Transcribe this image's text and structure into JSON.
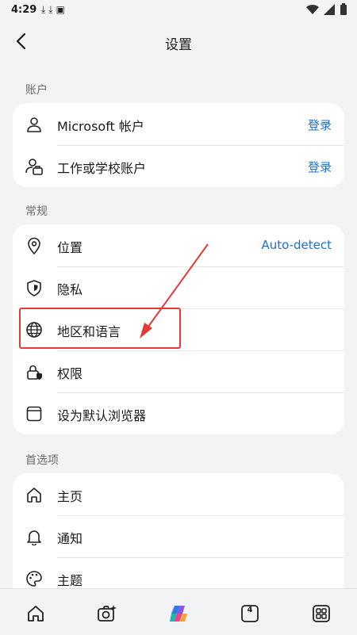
{
  "status": {
    "time": "4:29"
  },
  "appbar": {
    "title": "设置"
  },
  "sections": {
    "account": {
      "label": "账户",
      "items": [
        {
          "label": "Microsoft 帐户",
          "action": "登录",
          "icon": "person-icon"
        },
        {
          "label": "工作或学校账户",
          "action": "登录",
          "icon": "work-account-icon"
        }
      ]
    },
    "general": {
      "label": "常规",
      "items": [
        {
          "label": "位置",
          "action": "Auto-detect",
          "icon": "location-pin-icon"
        },
        {
          "label": "隐私",
          "icon": "shield-icon"
        },
        {
          "label": "地区和语言",
          "icon": "globe-icon"
        },
        {
          "label": "权限",
          "icon": "lock-icon"
        },
        {
          "label": "设为默认浏览器",
          "icon": "browser-window-icon"
        }
      ]
    },
    "preferences": {
      "label": "首选项",
      "items": [
        {
          "label": "主页",
          "icon": "home-icon"
        },
        {
          "label": "通知",
          "icon": "bell-icon"
        },
        {
          "label": "主题",
          "icon": "palette-icon"
        }
      ]
    }
  },
  "bottom_nav": {
    "tab_count": "4"
  },
  "colors": {
    "accent": "#1a6fd9",
    "highlight": "#e53935"
  }
}
